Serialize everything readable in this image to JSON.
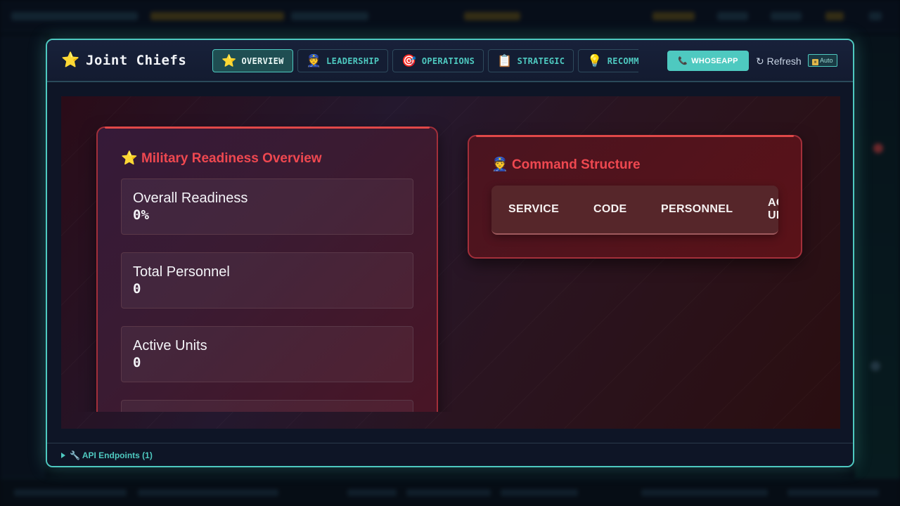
{
  "modal": {
    "title_icon": "⭐",
    "title": "Joint Chiefs",
    "tabs": [
      {
        "icon": "⭐",
        "label": "OVERVIEW"
      },
      {
        "icon": "👮",
        "label": "LEADERSHIP"
      },
      {
        "icon": "🎯",
        "label": "OPERATIONS"
      },
      {
        "icon": "📋",
        "label": "STRATEGIC"
      },
      {
        "icon": "💡",
        "label": "RECOMMENDATIONS"
      }
    ],
    "actions": {
      "whoseapp_icon": "📞",
      "whoseapp_label": "WHOSEAPP",
      "refresh_icon": "↻",
      "refresh_label": "Refresh",
      "auto_icon": "⏸",
      "auto_label": "Auto"
    }
  },
  "readiness": {
    "icon": "⭐",
    "title": "Military Readiness Overview",
    "stats": [
      {
        "label": "Overall Readiness",
        "value": "0%"
      },
      {
        "label": "Total Personnel",
        "value": "0"
      },
      {
        "label": "Active Units",
        "value": "0"
      }
    ]
  },
  "command": {
    "icon": "👮",
    "title": "Command Structure",
    "columns": [
      "SERVICE",
      "CODE",
      "PERSONNEL",
      "ACTIVE UNITS"
    ]
  },
  "footer": {
    "api_label": "🔧 API Endpoints (1)"
  },
  "colors": {
    "accent": "#4ec9c0",
    "card_title": "#ef4850",
    "card_border": "#a32f3a"
  }
}
